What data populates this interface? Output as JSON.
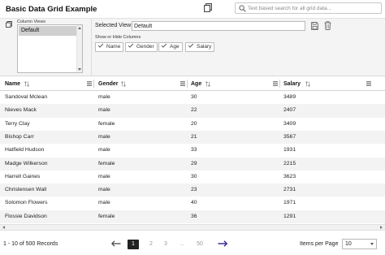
{
  "toolbar": {
    "title": "Basic Data Grid Example",
    "search_placeholder": "Text based search for all grid data..."
  },
  "settings": {
    "column_views_label": "Column Views",
    "column_views_options": [
      "Default"
    ],
    "selected_view_label": "Selected View:",
    "selected_view_value": "Default",
    "show_hide_label": "Show or Hide Columns",
    "column_toggles": [
      "Name",
      "Gender",
      "Age",
      "Salary"
    ]
  },
  "grid": {
    "columns": [
      "Name",
      "Gender",
      "Age",
      "Salary"
    ],
    "rows": [
      [
        "Sandoval Mclean",
        "male",
        "30",
        "3489"
      ],
      [
        "Nieves Mack",
        "male",
        "22",
        "2407"
      ],
      [
        "Terry Clay",
        "female",
        "20",
        "3409"
      ],
      [
        "Bishop Carr",
        "male",
        "21",
        "3567"
      ],
      [
        "Hatfield Hudson",
        "male",
        "33",
        "1931"
      ],
      [
        "Madge Wilkerson",
        "female",
        "29",
        "2215"
      ],
      [
        "Harrell Gaines",
        "male",
        "30",
        "3623"
      ],
      [
        "Christensen Wall",
        "male",
        "23",
        "2731"
      ],
      [
        "Solomon Flowers",
        "male",
        "40",
        "1971"
      ],
      [
        "Flossie Davidson",
        "female",
        "36",
        "1291"
      ]
    ]
  },
  "footer": {
    "records_text": "1 - 10  of 500 Records",
    "pages": [
      "1",
      "2",
      "3",
      "...",
      "50"
    ],
    "active_page": "1",
    "items_per_page_label": "Items per Page",
    "items_per_page_value": "10"
  },
  "colors": {
    "accent": "#3f2b96",
    "active_page_bg": "#222222",
    "alt_row": "#f3f3f3"
  },
  "icons": [
    "column-views-icon",
    "search-icon",
    "save-icon",
    "trash-icon",
    "sort-icon",
    "column-menu-icon",
    "prev-arrow-icon",
    "next-arrow-icon"
  ]
}
